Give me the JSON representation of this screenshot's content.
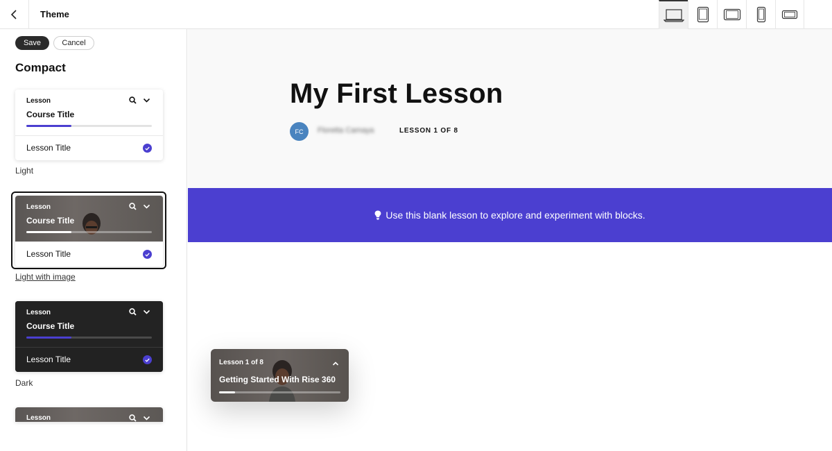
{
  "header": {
    "title": "Theme",
    "devices": [
      {
        "name": "laptop",
        "active": true
      },
      {
        "name": "tablet-portrait",
        "active": false
      },
      {
        "name": "tablet-landscape",
        "active": false
      },
      {
        "name": "phone-portrait",
        "active": false
      },
      {
        "name": "phone-landscape",
        "active": false
      }
    ]
  },
  "sidebar": {
    "save_label": "Save",
    "cancel_label": "Cancel",
    "section_title": "Compact",
    "themes": [
      {
        "lesson_label": "Lesson",
        "course_title": "Course Title",
        "lesson_title": "Lesson Title",
        "caption": "Light",
        "progress": 0.36
      },
      {
        "lesson_label": "Lesson",
        "course_title": "Course Title",
        "lesson_title": "Lesson Title",
        "caption": "Light with image",
        "progress": 0.36,
        "selected": true
      },
      {
        "lesson_label": "Lesson",
        "course_title": "Course Title",
        "lesson_title": "Lesson Title",
        "caption": "Dark",
        "progress": 0.36
      },
      {
        "lesson_label": "Lesson"
      }
    ]
  },
  "main": {
    "lesson_title": "My First Lesson",
    "avatar_initials": "FC",
    "author": "Floretta Camaya",
    "lesson_count": "LESSON 1 OF 8",
    "banner_text": "Use this blank lesson to explore and experiment with blocks.",
    "floating_nav": {
      "lesson_label": "Lesson 1 of 8",
      "course_title": "Getting Started With Rise 360",
      "progress": 0.13
    }
  },
  "colors": {
    "accent": "#4b3fd0",
    "dark": "#232323",
    "avatar": "#4a84bf"
  }
}
